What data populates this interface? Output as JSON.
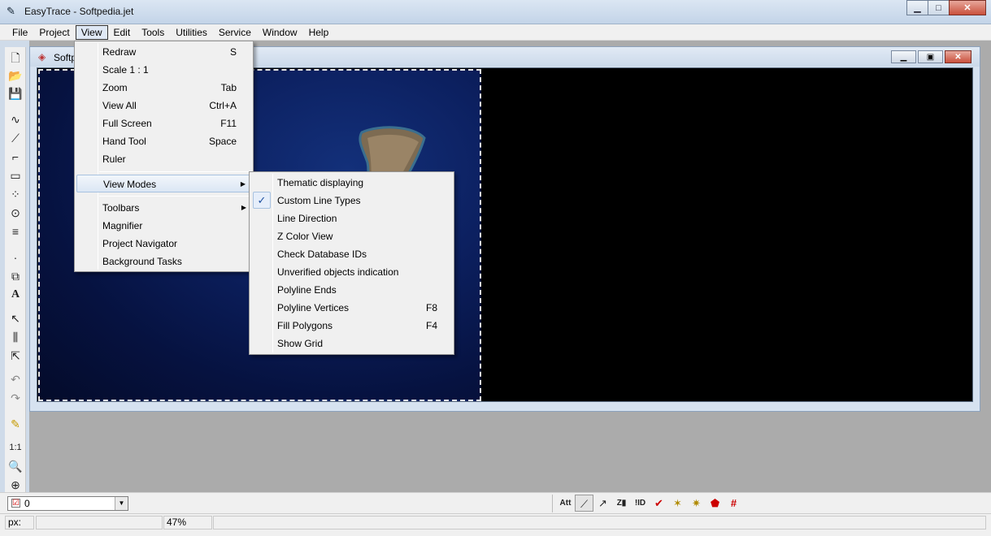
{
  "window": {
    "title": "EasyTrace - Softpedia.jet",
    "app_icon": "easytrace-icon"
  },
  "menubar": [
    "File",
    "Project",
    "View",
    "Edit",
    "Tools",
    "Utilities",
    "Service",
    "Window",
    "Help"
  ],
  "mdi": {
    "title": "Softp"
  },
  "view_menu": {
    "items": [
      {
        "label": "Redraw",
        "shortcut": "S"
      },
      {
        "label": "Scale 1 : 1",
        "shortcut": ""
      },
      {
        "label": "Zoom",
        "shortcut": "Tab"
      },
      {
        "label": "View All",
        "shortcut": "Ctrl+A"
      },
      {
        "label": "Full Screen",
        "shortcut": "F11"
      },
      {
        "label": "Hand Tool",
        "shortcut": "Space"
      },
      {
        "label": "Ruler",
        "shortcut": ""
      },
      {
        "label": "View Modes",
        "shortcut": ""
      },
      {
        "label": "Toolbars",
        "shortcut": ""
      },
      {
        "label": "Magnifier",
        "shortcut": ""
      },
      {
        "label": "Project Navigator",
        "shortcut": ""
      },
      {
        "label": "Background Tasks",
        "shortcut": ""
      }
    ]
  },
  "view_modes_menu": {
    "items": [
      {
        "label": "Thematic displaying",
        "shortcut": ""
      },
      {
        "label": "Custom Line Types",
        "shortcut": "",
        "checked": true
      },
      {
        "label": "Line Direction",
        "shortcut": ""
      },
      {
        "label": "Z Color View",
        "shortcut": ""
      },
      {
        "label": "Check Database IDs",
        "shortcut": ""
      },
      {
        "label": "Unverified objects indication",
        "shortcut": ""
      },
      {
        "label": "Polyline Ends",
        "shortcut": ""
      },
      {
        "label": "Polyline Vertices",
        "shortcut": "F8"
      },
      {
        "label": "Fill Polygons",
        "shortcut": "F4"
      },
      {
        "label": "Show Grid",
        "shortcut": ""
      }
    ]
  },
  "bottom_toolbar": {
    "layer_value": "0",
    "icons": [
      "attribute-icon",
      "line-style-icon",
      "line-direction-icon",
      "z-color-icon",
      "check-id-icon",
      "verify-icon",
      "polyline-ends-icon",
      "polyline-vertices-icon",
      "fill-polygons-icon",
      "grid-icon"
    ]
  },
  "statusbar": {
    "coord_label": "px:",
    "coord_value": "",
    "zoom": "47%"
  }
}
